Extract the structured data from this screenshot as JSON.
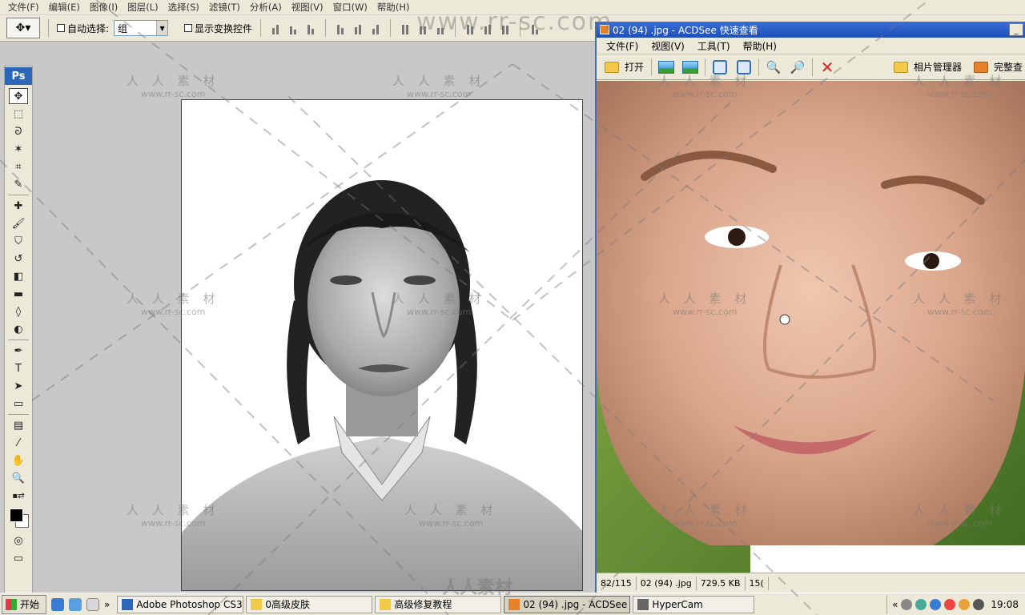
{
  "photoshop": {
    "menu": [
      "文件(F)",
      "编辑(E)",
      "图像(I)",
      "图层(L)",
      "选择(S)",
      "滤镜(T)",
      "分析(A)",
      "视图(V)",
      "窗口(W)",
      "帮助(H)"
    ],
    "options": {
      "auto_select_label": "自动选择:",
      "auto_select_value": "组",
      "show_transform_label": "显示变换控件"
    },
    "logo": "Ps"
  },
  "acdsee": {
    "title": "02 (94) .jpg - ACDSee 快速查看",
    "menu": [
      "文件(F)",
      "视图(V)",
      "工具(T)",
      "帮助(H)"
    ],
    "toolbar": {
      "open_label": "打开",
      "photo_manager_label": "相片管理器",
      "full_label": "完整查"
    },
    "status": {
      "index": "82/115",
      "filename": "02 (94) .jpg",
      "size": "729.5 KB",
      "extra": "15("
    }
  },
  "taskbar": {
    "start_label": "开始",
    "chevron": "»",
    "tasks": [
      "Adobe Photoshop CS3 E...",
      "0高级皮肤",
      "高级修复教程",
      "02 (94) .jpg - ACDSee ...",
      "HyperCam"
    ],
    "tray_chevron": "«",
    "clock": "19:08"
  },
  "watermark": {
    "url": "www.rr-sc.com",
    "stamp_cn": "人 人 素 材",
    "stamp_en": "www.rr-sc.com",
    "bottom_text": "人人素材"
  }
}
